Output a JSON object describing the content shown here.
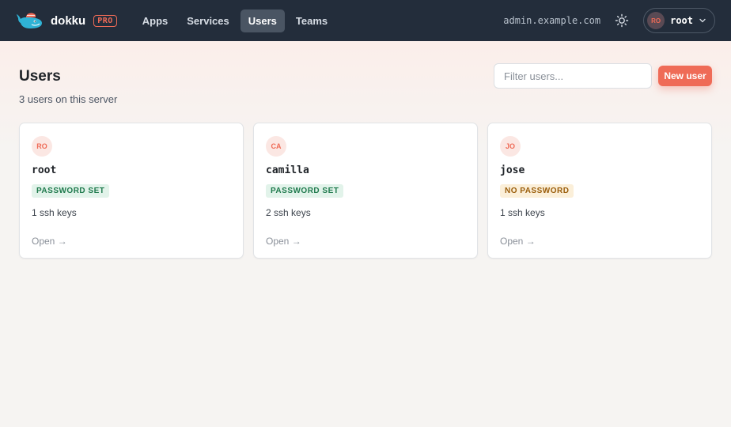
{
  "brand": {
    "name": "dokku",
    "badge": "PRO"
  },
  "nav": [
    {
      "label": "Apps",
      "active": false
    },
    {
      "label": "Services",
      "active": false
    },
    {
      "label": "Users",
      "active": true
    },
    {
      "label": "Teams",
      "active": false
    }
  ],
  "host": "admin.example.com",
  "user_menu": {
    "initials": "RO",
    "name": "root"
  },
  "page": {
    "title": "Users",
    "subtitle": "3 users on this server",
    "filter_placeholder": "Filter users...",
    "new_button": "New user"
  },
  "users": [
    {
      "initials": "RO",
      "name": "root",
      "status": "PASSWORD SET",
      "keys": "1 ssh keys",
      "open": "Open →"
    },
    {
      "initials": "CA",
      "name": "camilla",
      "status": "PASSWORD SET",
      "keys": "2 ssh keys",
      "open": "Open →"
    },
    {
      "initials": "JO",
      "name": "jose",
      "status": "NO PASSWORD",
      "keys": "1 ssh keys",
      "open": "Open →"
    }
  ],
  "colors": {
    "topbar": "#232d3b",
    "accent": "#ef6b57",
    "status_ok": "#1f7a4d",
    "status_warn": "#9a5d0a",
    "whale": "#2fb3d6"
  },
  "icons": [
    "whale-logo-icon",
    "sun-icon",
    "chevron-down-icon",
    "arrow-right-icon"
  ]
}
